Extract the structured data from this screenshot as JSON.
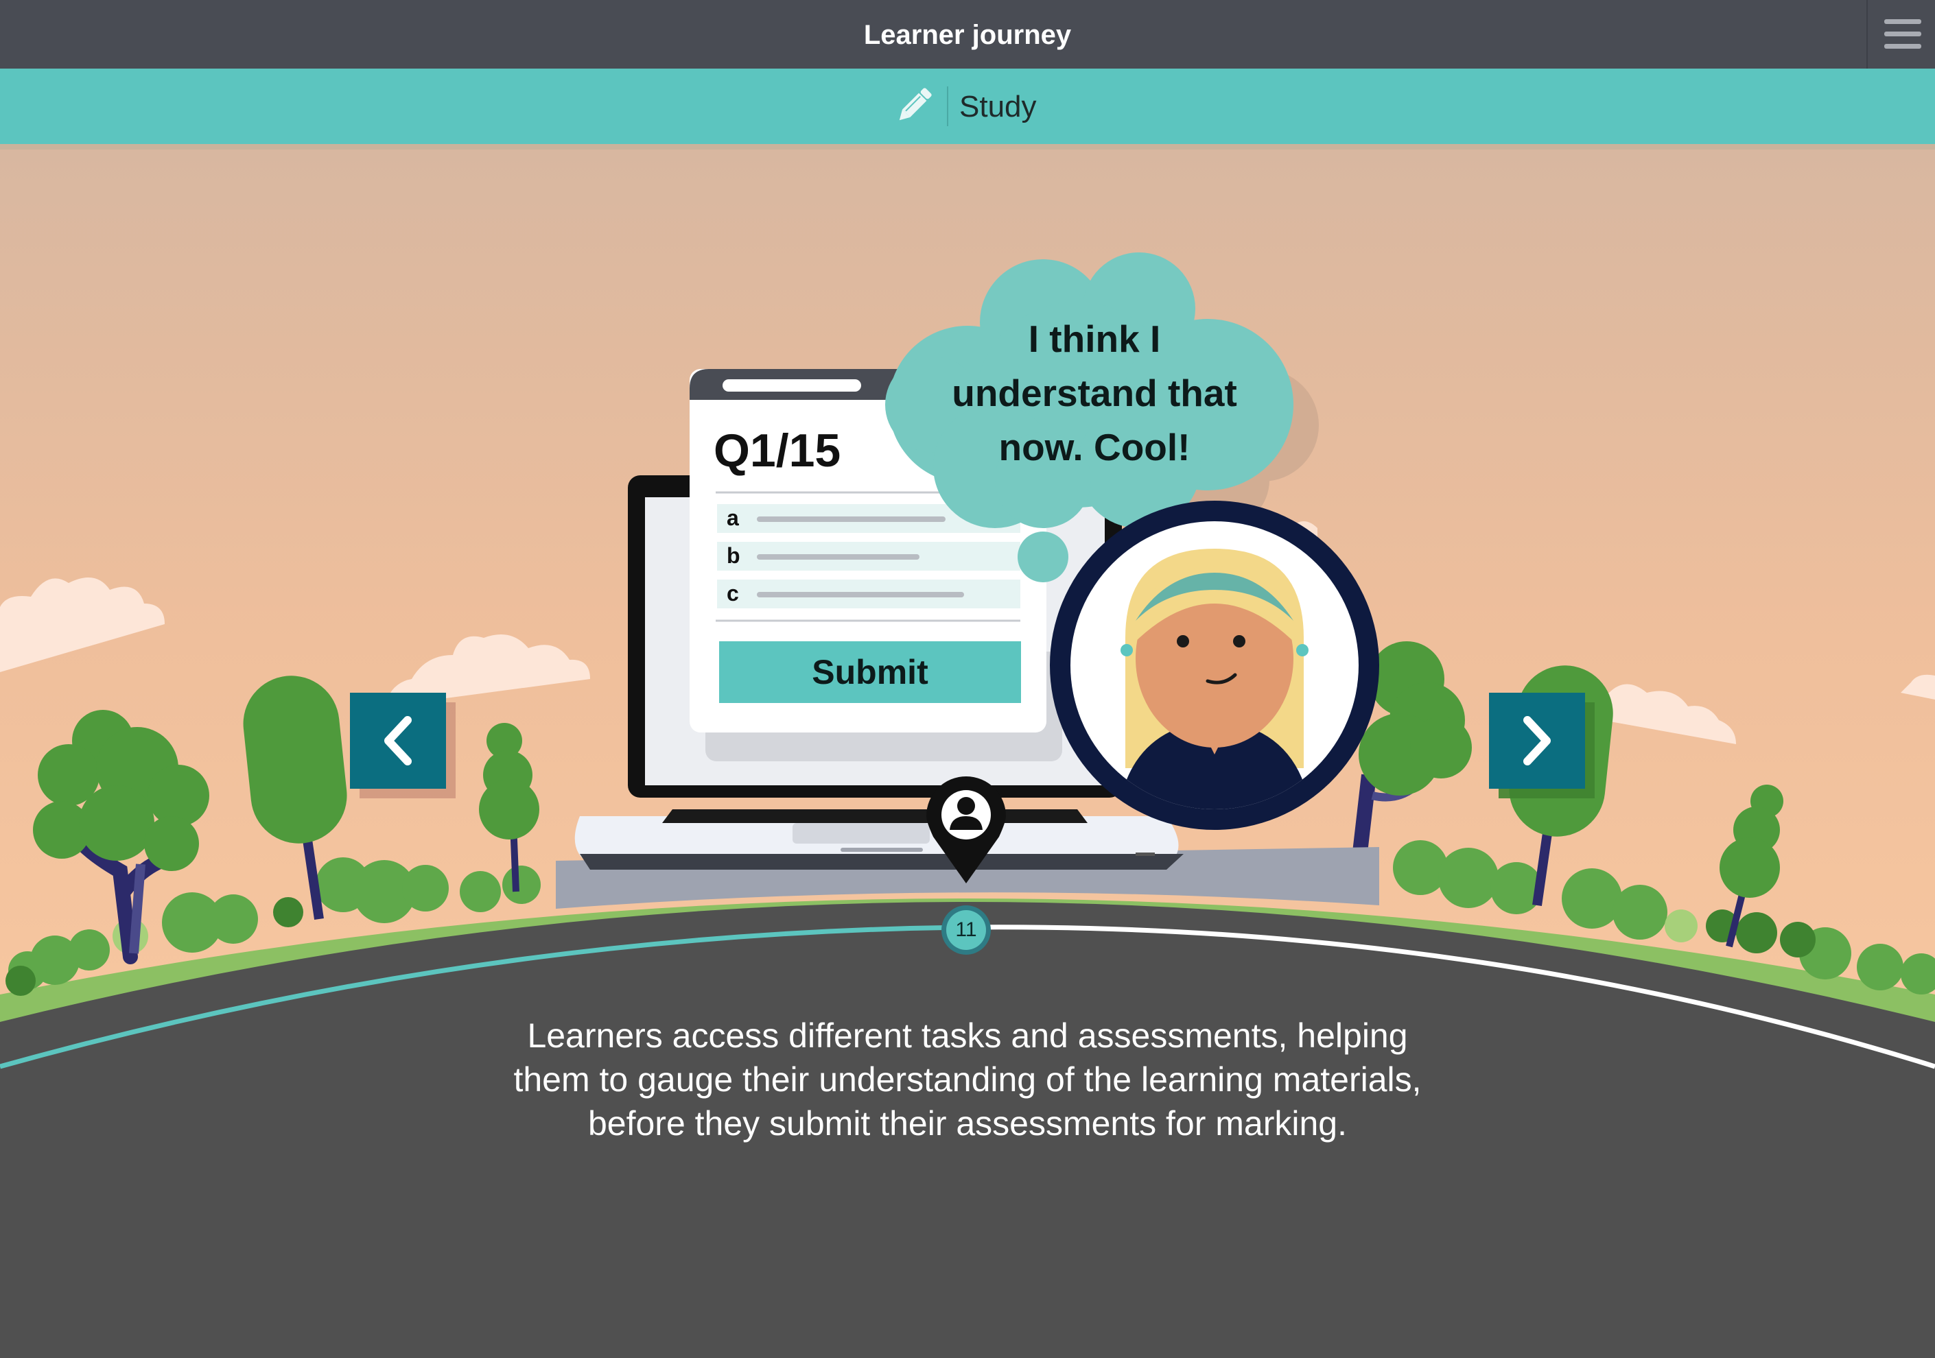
{
  "topbar": {
    "title": "Learner journey",
    "menu_icon": "hamburger-menu-icon"
  },
  "section": {
    "icon": "pencil-icon",
    "label": "Study"
  },
  "laptop_screen": {
    "question_counter": "Q1/15",
    "options": [
      "a",
      "b",
      "c"
    ],
    "submit_label": "Submit"
  },
  "thought_bubble": {
    "lines": [
      "I think I",
      "understand that",
      "now. Cool!"
    ]
  },
  "navigation": {
    "prev_icon": "chevron-left-icon",
    "next_icon": "chevron-right-icon",
    "step_number": "11",
    "step_marker_icon": "user-location-pin-icon",
    "progress_fraction": 0.5
  },
  "caption": {
    "lines": [
      "Learners access different tasks and assessments, helping",
      "them to gauge their understanding of the learning materials,",
      "before they submit their assessments for marking."
    ]
  },
  "colors": {
    "topbar": "#494c54",
    "section_bar": "#5cc5bf",
    "nav_button": "#0b6e80",
    "road": "#505050",
    "progress_done": "#5cc5bf",
    "progress_remaining": "#ffffff",
    "grass": "#8cc063",
    "tree": "#4f9a3c"
  }
}
